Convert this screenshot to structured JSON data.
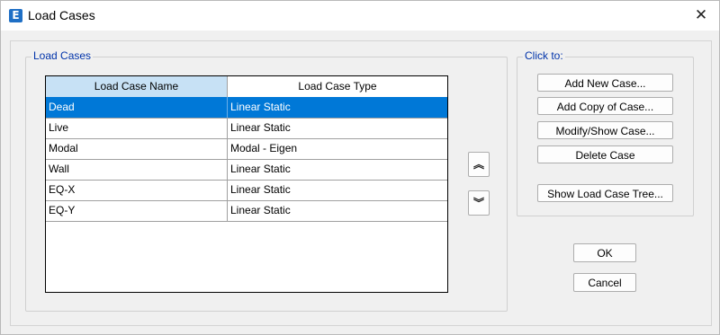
{
  "window": {
    "title": "Load Cases",
    "app_icon_letter": "E",
    "close_glyph": "✕"
  },
  "load_cases_group": {
    "label": "Load Cases",
    "table": {
      "headers": [
        "Load Case Name",
        "Load Case Type"
      ],
      "rows": [
        {
          "name": "Dead",
          "type": "Linear Static"
        },
        {
          "name": "Live",
          "type": "Linear Static"
        },
        {
          "name": "Modal",
          "type": "Modal - Eigen"
        },
        {
          "name": "Wall",
          "type": "Linear Static"
        },
        {
          "name": "EQ-X",
          "type": "Linear Static"
        },
        {
          "name": "EQ-Y",
          "type": "Linear Static"
        }
      ],
      "selected_row": "Dead"
    },
    "move_up_glyph": "︽",
    "move_down_glyph": "︾"
  },
  "click_to_group": {
    "label": "Click to:",
    "add_new_label": "Add New Case...",
    "add_copy_label": "Add Copy of Case...",
    "modify_show_label": "Modify/Show Case...",
    "delete_label": "Delete Case",
    "show_tree_label": "Show Load Case Tree..."
  },
  "dialog_buttons": {
    "ok_label": "OK",
    "cancel_label": "Cancel"
  },
  "colors": {
    "selection": "#0078d7",
    "header_highlight": "#c7e1f5",
    "group_label": "#0033aa",
    "app_icon": "#1f6fc5"
  }
}
